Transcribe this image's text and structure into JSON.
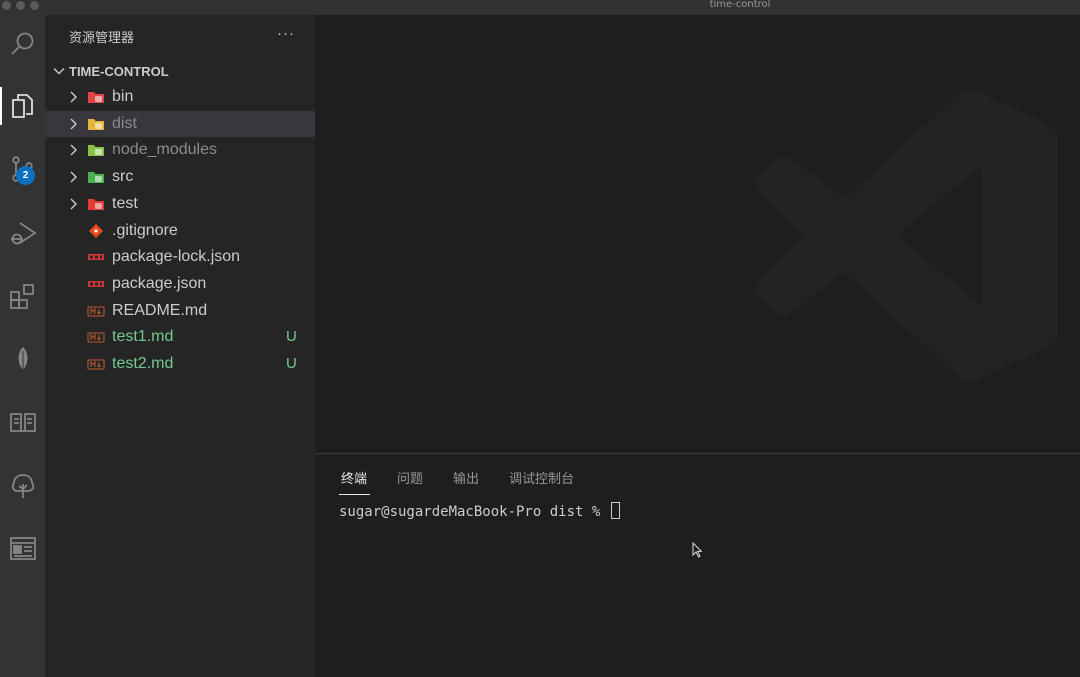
{
  "window": {
    "title": "time-control"
  },
  "activity_bar": {
    "items": [
      {
        "name": "search-icon"
      },
      {
        "name": "explorer-icon",
        "active": true
      },
      {
        "name": "source-control-icon",
        "badge": "2"
      },
      {
        "name": "run-debug-icon"
      },
      {
        "name": "extensions-icon"
      },
      {
        "name": "leaf-icon"
      },
      {
        "name": "book-icon"
      },
      {
        "name": "tree-icon"
      },
      {
        "name": "browser-preview-icon"
      }
    ]
  },
  "sidebar": {
    "title": "资源管理器",
    "more_label": "···",
    "folder": "TIME-CONTROL",
    "items": [
      {
        "label": "bin",
        "type": "folder",
        "icon": "bin-folder-icon",
        "color": "#e04545"
      },
      {
        "label": "dist",
        "type": "folder",
        "icon": "dist-folder-icon",
        "color": "#e8b43b",
        "selected": true,
        "dim": true
      },
      {
        "label": "node_modules",
        "type": "folder",
        "icon": "node-modules-folder-icon",
        "color": "#8bc34a",
        "dim": true
      },
      {
        "label": "src",
        "type": "folder",
        "icon": "src-folder-icon",
        "color": "#4caf50"
      },
      {
        "label": "test",
        "type": "folder",
        "icon": "test-folder-icon",
        "color": "#e53935"
      },
      {
        "label": ".gitignore",
        "type": "file",
        "icon": "git-file-icon",
        "color": "#e64a19"
      },
      {
        "label": "package-lock.json",
        "type": "file",
        "icon": "npm-file-icon",
        "color": "#cb3837"
      },
      {
        "label": "package.json",
        "type": "file",
        "icon": "npm-file-icon",
        "color": "#cb3837"
      },
      {
        "label": "README.md",
        "type": "file",
        "icon": "markdown-file-icon",
        "color": "#a0522d"
      },
      {
        "label": "test1.md",
        "type": "file",
        "icon": "markdown-file-icon",
        "color": "#a0522d",
        "status": "U",
        "untracked": true
      },
      {
        "label": "test2.md",
        "type": "file",
        "icon": "markdown-file-icon",
        "color": "#a0522d",
        "status": "U",
        "untracked": true
      }
    ]
  },
  "panel": {
    "tabs": [
      {
        "label": "终端",
        "active": true
      },
      {
        "label": "问题"
      },
      {
        "label": "输出"
      },
      {
        "label": "调试控制台"
      }
    ],
    "terminal_prompt": "sugar@sugardeMacBook-Pro dist % "
  },
  "colors": {
    "accent_badge": "#0e70c0",
    "untracked": "#73c991"
  }
}
